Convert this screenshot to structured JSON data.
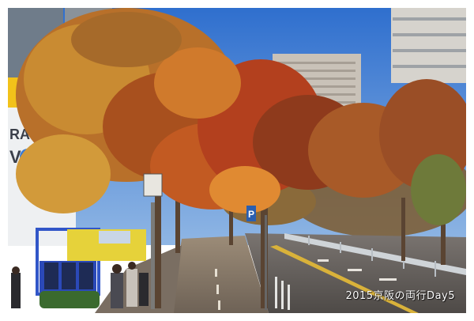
{
  "image": {
    "description_free": true,
    "sign": {
      "line1": "RAVA",
      "line2": "VO"
    },
    "street_sign": "P",
    "watermark": "2015京阪の両行Day5"
  },
  "colors": {
    "sky": "#3f7fd0",
    "autumn_orange": "#d2691e",
    "autumn_red": "#b8401f",
    "foliage_yellow": "#c8a030",
    "road": "#5a5652",
    "sidewalk": "#8a7a6a"
  }
}
